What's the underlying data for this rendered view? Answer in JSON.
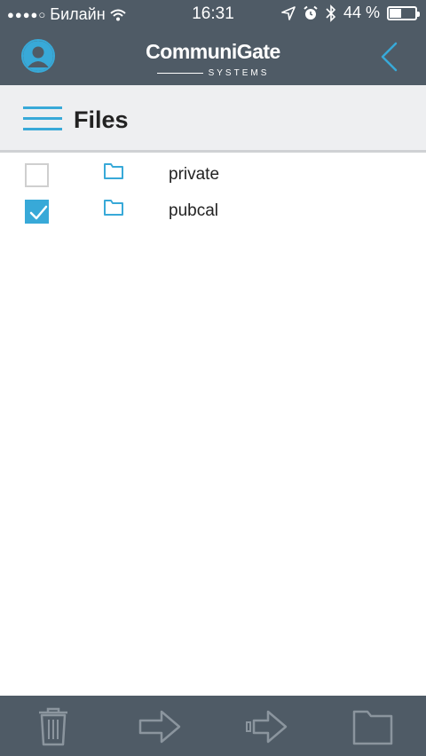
{
  "status_bar": {
    "carrier": "Билайн",
    "time": "16:31",
    "battery": "44 %",
    "battery_level": 0.44
  },
  "header": {
    "brand": "CommuniGate",
    "brand_sub": "SYSTEMS"
  },
  "page": {
    "title": "Files"
  },
  "files": [
    {
      "name": "private",
      "checked": false,
      "icon": "folder-icon"
    },
    {
      "name": "pubcal",
      "checked": true,
      "icon": "folder-icon"
    }
  ],
  "toolbar": {
    "icons": [
      "trash-icon",
      "move-arrow-icon",
      "copy-arrow-icon",
      "folder-icon"
    ]
  },
  "colors": {
    "bar": "#4f5b66",
    "accent": "#38a9d8"
  }
}
